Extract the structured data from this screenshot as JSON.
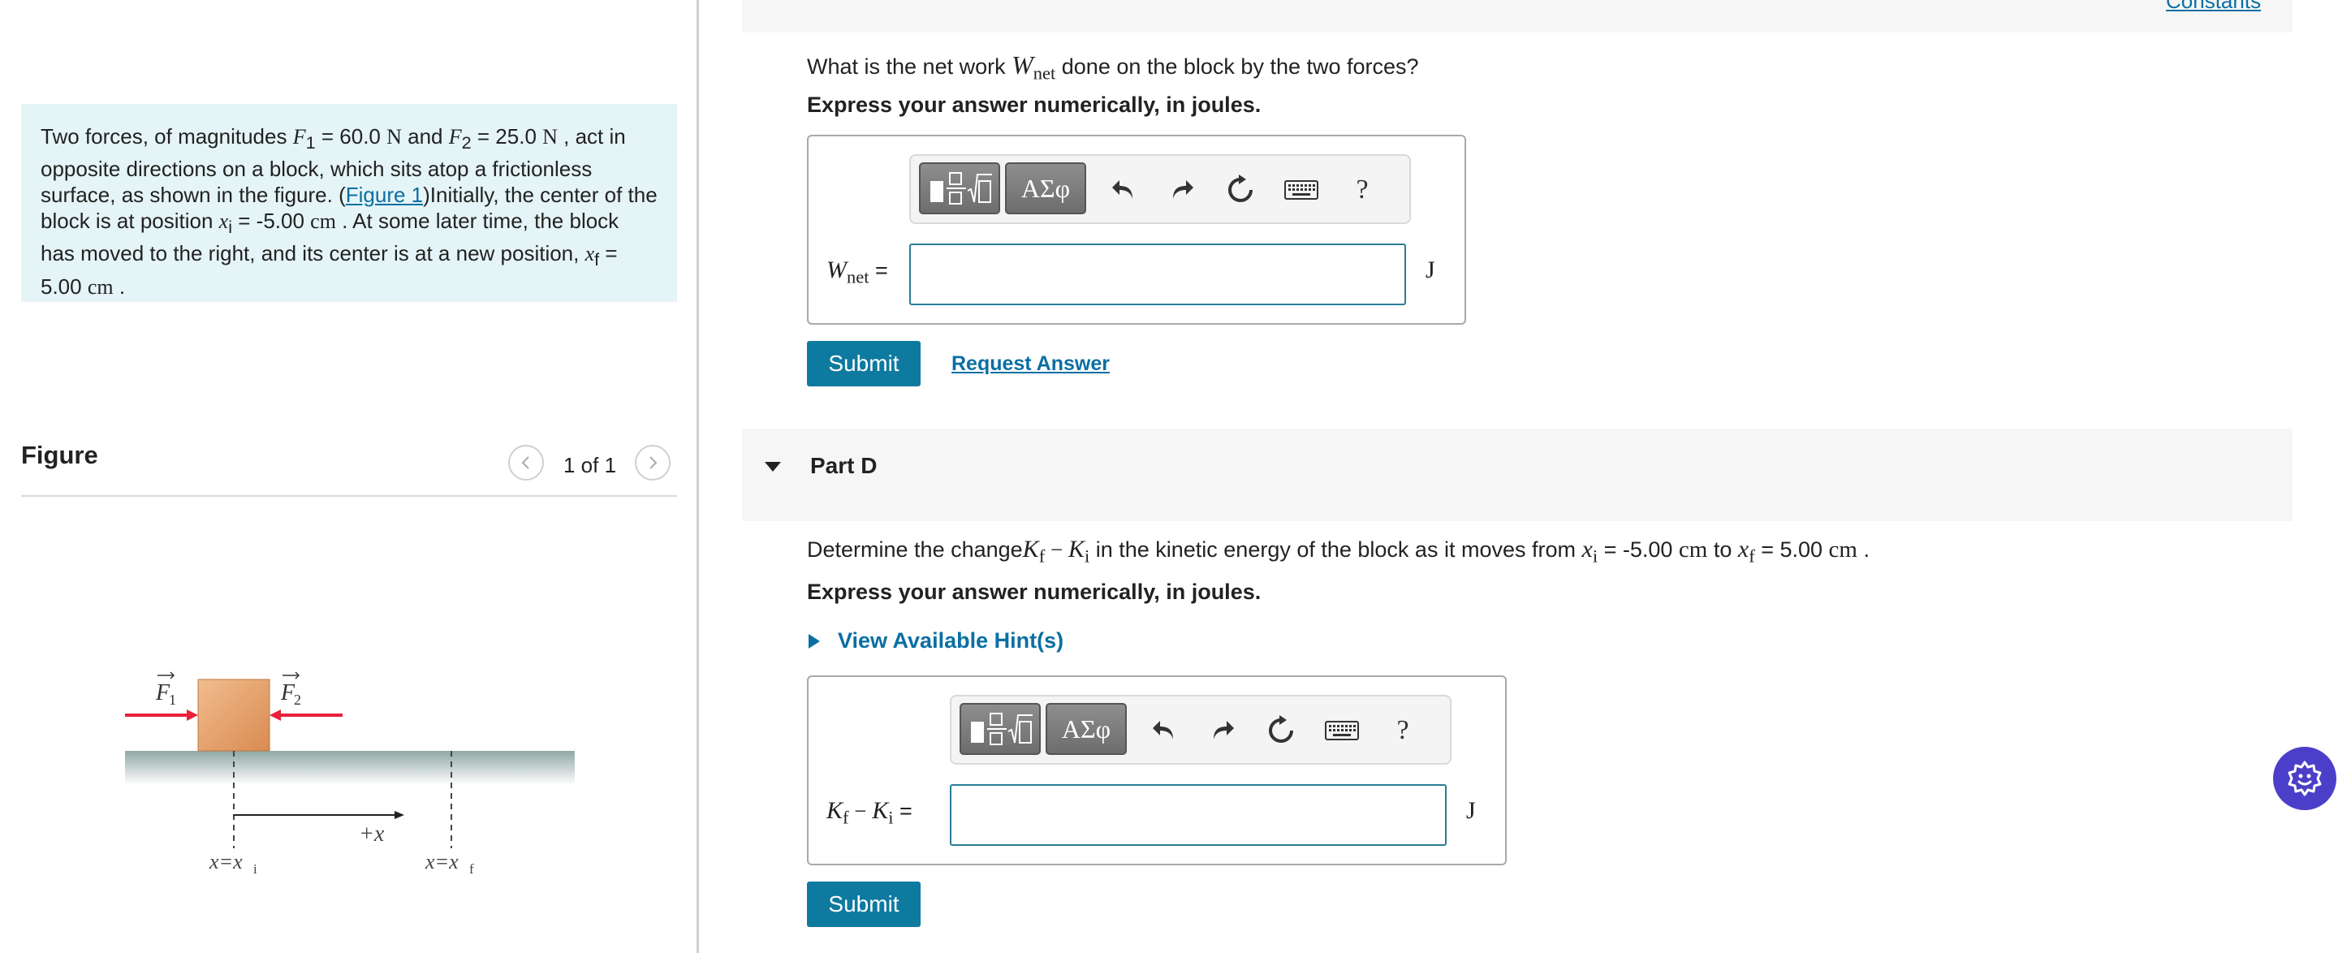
{
  "left": {
    "problem": {
      "t1": "Two forces, of magnitudes ",
      "f1_sym": "F",
      "f1_sub": "1",
      "t2": " = 60.0 ",
      "unit_n1": "N",
      "t3": " and ",
      "f2_sym": "F",
      "f2_sub": "2",
      "t4": " = 25.0 ",
      "unit_n2": "N",
      "t5": " , act in opposite directions on a block, which sits atop a frictionless surface, as shown in the figure. (",
      "figure_link": "Figure 1",
      "t6": ")Initially, the center of the block is at position ",
      "xi_sym": "x",
      "xi_sub": "i",
      "t7": " = -5.00 ",
      "unit_cm1": "cm",
      "t8": " . At some later time, the block has moved to the right, and its center is at a new position, ",
      "xf_sym": "x",
      "xf_sub": "f",
      "t9": " = 5.00 ",
      "unit_cm2": "cm",
      "t10": " ."
    },
    "figure": {
      "title": "Figure",
      "pager": "1 of 1",
      "f1_label": "F",
      "f1_sub": "1",
      "f2_label": "F",
      "f2_sub": "2",
      "plus_x": "+x",
      "xi_label": "x=x",
      "xi_sub": "i",
      "xf_label": "x=x",
      "xf_sub": "f"
    }
  },
  "partC": {
    "link_top": "Constants",
    "question_pre": "What is the net work ",
    "w_sym": "W",
    "w_sub": "net",
    "question_post": " done on the block by the two forces?",
    "instruction": "Express your answer numerically, in joules.",
    "toolbar": {
      "greek": "ΑΣφ",
      "help": "?"
    },
    "input_label_sym": "W",
    "input_label_sub": "net",
    "input_label_eq": " =",
    "input_value": "",
    "unit": "J",
    "submit": "Submit",
    "request": "Request Answer"
  },
  "partD": {
    "title": "Part D",
    "question_pre": "Determine the change",
    "kf_sym": "K",
    "kf_sub": "f",
    "minus": " − ",
    "ki_sym": "K",
    "ki_sub": "i",
    "question_mid": " in the kinetic energy of the block as it moves from ",
    "xi_sym": "x",
    "xi_sub": "i",
    "q_xi_val": " = -5.00 ",
    "unit_cm1": "cm",
    "q_to": " to ",
    "xf_sym": "x",
    "xf_sub": "f",
    "q_xf_val": " = 5.00 ",
    "unit_cm2": "cm",
    "q_end": " .",
    "instruction": "Express your answer numerically, in joules.",
    "hints": "View Available Hint(s)",
    "toolbar": {
      "greek": "ΑΣφ",
      "help": "?"
    },
    "input_label_eq": " =",
    "input_value": "",
    "unit": "J",
    "submit": "Submit"
  },
  "colors": {
    "accent": "#0e7aa0",
    "problem_bg": "#e5f4f6",
    "force_arrow": "#e8203a",
    "block": "#e39a60",
    "assistant": "#4b3fc9"
  }
}
